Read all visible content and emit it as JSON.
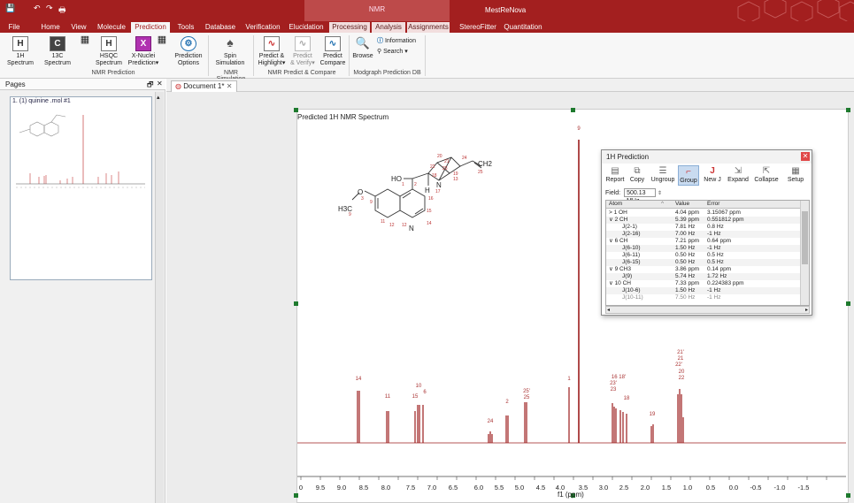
{
  "app": {
    "title": "MestReNova",
    "context_group": "NMR"
  },
  "qat": {
    "save": "💾",
    "undo": "↶",
    "redo": "↷",
    "print": "🖶"
  },
  "menu": {
    "tabs": [
      "File",
      "Home",
      "View",
      "Molecule",
      "Prediction",
      "Tools",
      "Database",
      "Verification",
      "Elucidation",
      "Processing",
      "Analysis",
      "Assignments",
      "StereoFitter",
      "Quantitation"
    ],
    "active": "Prediction"
  },
  "ribbon": {
    "buttons": [
      {
        "label": "1H\nSpectrum",
        "icon": "H"
      },
      {
        "label": "13C\nSpectrum",
        "icon": "C"
      },
      {
        "label": "",
        "icon": "▦"
      },
      {
        "label": "HSQC\nSpectrum",
        "icon": "H"
      },
      {
        "label": "X-Nuclei\nPrediction▾",
        "icon": "X"
      },
      {
        "label": "",
        "icon": "▦"
      },
      {
        "label": "Prediction\nOptions",
        "icon": "⚙"
      },
      {
        "label": "Spin\nSimulation",
        "icon": "♠"
      },
      {
        "label": "Predict &\nHighlight▾",
        "icon": "∿"
      },
      {
        "label": "Predict\n& Verify▾",
        "icon": "∿"
      },
      {
        "label": "Predict\nCompare",
        "icon": "∿"
      },
      {
        "label": "Browse",
        "icon": "🔍"
      }
    ],
    "info_label": "Information",
    "search_label": "Search ▾",
    "groups": [
      "NMR Prediction",
      "NMR Simulation",
      "NMR Predict & Compare",
      "Modgraph Prediction DB"
    ]
  },
  "pages_pane": {
    "title": "Pages",
    "pin": "🗗",
    "close": "✕",
    "item": "1. (1) quinine .mol #1"
  },
  "document": {
    "tab": "Document 1*",
    "close": "✕"
  },
  "spectrum": {
    "title": "Predicted 1H NMR Spectrum",
    "xaxis_label": "f1 (ppm)",
    "tick_labels": [
      "0",
      "9.5",
      "9.0",
      "8.5",
      "8.0",
      "7.5",
      "7.0",
      "6.5",
      "6.0",
      "5.5",
      "5.0",
      "4.5",
      "4.0",
      "3.5",
      "3.0",
      "2.5",
      "2.0",
      "1.5",
      "1.0",
      "0.5",
      "0.0",
      "-0.5",
      "-1.0",
      "-1.5"
    ],
    "peak_labels": [
      "14",
      "11",
      "15",
      "10",
      "6",
      "24",
      "2",
      "25'",
      "25",
      "1",
      "9",
      "16 18'",
      "23'",
      "23",
      "18",
      "19",
      "21'",
      "21",
      "22'",
      "20",
      "22"
    ]
  },
  "molecule": {
    "atoms": [
      "HO",
      "H3C",
      "N",
      "N",
      "H",
      "O",
      "20",
      "21",
      "22",
      "23",
      "24",
      "25",
      "18",
      "19",
      "13",
      "17",
      "16",
      "1",
      "2",
      "3",
      "4",
      "5",
      "6",
      "7",
      "8",
      "9",
      "10",
      "11",
      "12",
      "14",
      "15",
      "CH2"
    ]
  },
  "prediction": {
    "title": "1H Prediction",
    "toolbar": [
      {
        "label": "Report",
        "icon": "▤"
      },
      {
        "label": "Copy",
        "icon": "⧉"
      },
      {
        "label": "Ungroup",
        "icon": "☰"
      },
      {
        "label": "Group",
        "icon": "⌐"
      },
      {
        "label": "New J",
        "icon": "J"
      },
      {
        "label": "Expand",
        "icon": "⇲"
      },
      {
        "label": "Collapse",
        "icon": "⇱"
      },
      {
        "label": "Setup",
        "icon": "▦"
      }
    ],
    "field_label": "Field:",
    "field_value": "500.13 MHz",
    "columns": [
      "Atom",
      "Value",
      "Error"
    ],
    "rows": [
      {
        "atom": "> 1  OH",
        "value": "4.04 ppm",
        "error": "3.15067 ppm"
      },
      {
        "atom": "∨ 2  CH",
        "value": "5.39 ppm",
        "error": "0.551812 ppm"
      },
      {
        "atom": "J(2-1)",
        "value": "7.81 Hz",
        "error": "0.8 Hz"
      },
      {
        "atom": "J(2-16)",
        "value": "7.00 Hz",
        "error": "-1 Hz"
      },
      {
        "atom": "∨ 6  CH",
        "value": "7.21 ppm",
        "error": "0.64 ppm"
      },
      {
        "atom": "J(6-10)",
        "value": "1.50 Hz",
        "error": "-1 Hz"
      },
      {
        "atom": "J(6-11)",
        "value": "0.50 Hz",
        "error": "0.5 Hz"
      },
      {
        "atom": "J(6-15)",
        "value": "0.50 Hz",
        "error": "0.5 Hz"
      },
      {
        "atom": "∨ 9  CH3",
        "value": "3.86 ppm",
        "error": "0.14 ppm"
      },
      {
        "atom": "J(9)",
        "value": "5.74 Hz",
        "error": "1.72 Hz"
      },
      {
        "atom": "∨ 10  CH",
        "value": "7.33 ppm",
        "error": "0.224383 ppm"
      },
      {
        "atom": "J(10-6)",
        "value": "1.50 Hz",
        "error": "-1 Hz"
      },
      {
        "atom": "J(10-11)",
        "value": "7.50 Hz",
        "error": "-1 Hz"
      }
    ]
  }
}
